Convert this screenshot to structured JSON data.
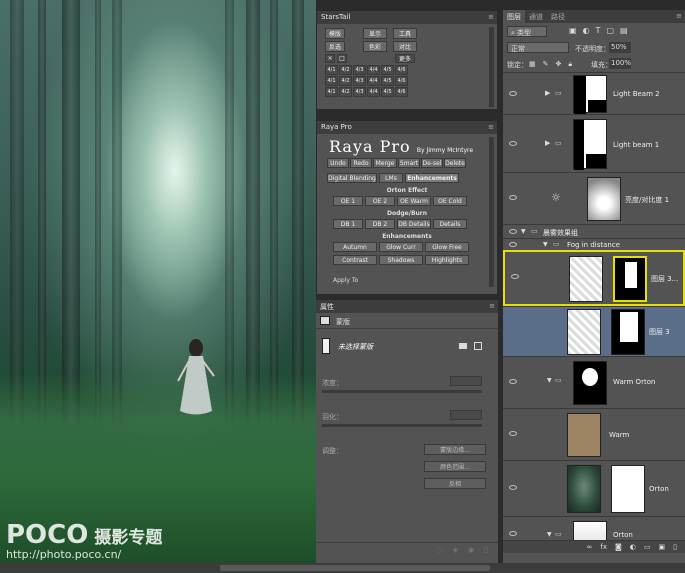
{
  "photo": {
    "logo_brand": "POCO",
    "logo_title": "摄影专题",
    "logo_url": "http://photo.poco.cn/"
  },
  "starstail": {
    "title": "StarsTail",
    "row1": [
      "模版",
      "显示",
      "工具"
    ],
    "row2": [
      "反选",
      "色彩",
      "对比"
    ],
    "row3_right": "更多",
    "row3_left": [
      "×",
      "□"
    ],
    "grid": [
      "4/1",
      "4/2",
      "4/3",
      "4/4",
      "4/5",
      "4/6",
      "4/1",
      "4/2",
      "4/3",
      "4/4",
      "4/5",
      "4/6",
      "4/1",
      "4/2",
      "4/3",
      "4/4",
      "4/5",
      "4/6"
    ]
  },
  "raya": {
    "title": "Raya Pro",
    "logo": "Raya Pro",
    "by": "By Jimmy McIntyre",
    "actions": [
      "Undo",
      "Redo",
      "Merge",
      "Smart",
      "De-sel",
      "Delete"
    ],
    "tabs": [
      "Digital Blending",
      "LMs",
      "Enhancements"
    ],
    "orton_heading": "Orton Effect",
    "orton": [
      "OE 1",
      "OE 2",
      "OE Warm",
      "OE Cold"
    ],
    "dodge_heading": "Dodge/Burn",
    "dodge": [
      "DB 1",
      "DB 2",
      "DB Details",
      "Details"
    ],
    "enh_heading": "Enhancements",
    "enh1": [
      "Autumn",
      "Glow Curr",
      "Glow Free"
    ],
    "enh2": [
      "Contrast",
      "Shadows",
      "Highlights"
    ],
    "apply_to": "Apply To"
  },
  "props": {
    "title": "属性",
    "section": "蒙版",
    "mask_name": "未选择蒙版",
    "density_label": "浓度：",
    "feather_label": "羽化：",
    "adjust_label": "调整：",
    "buttons": [
      "蒙版边缘...",
      "颜色范围...",
      "反相"
    ]
  },
  "layers": {
    "tabs": [
      "图层",
      "通道",
      "路径"
    ],
    "kind": "类型",
    "blend": "正常",
    "opacity_label": "不透明度：",
    "opacity": "50%",
    "lock_label": "锁定：",
    "fill_label": "填充：",
    "fill": "100%",
    "items": [
      {
        "name": "Light Beam 2"
      },
      {
        "name": "Light beam 1"
      },
      {
        "name": "亮度/对比度 1"
      },
      {
        "name": "晨雾效果组"
      },
      {
        "name": "Fog in distance"
      },
      {
        "name": "图层 3..."
      },
      {
        "name": "图层 3"
      },
      {
        "name": "Warm Orton"
      },
      {
        "name": "Warm"
      },
      {
        "name": "Orton"
      },
      {
        "name": "Orton"
      }
    ],
    "footer_icons": [
      "link-icon",
      "fx-icon",
      "mask-icon",
      "adjustment-icon",
      "folder-icon",
      "new-layer-icon",
      "trash-icon"
    ]
  },
  "colors": {
    "panel_bg": "#535353",
    "selected_layer": "#5a6e88",
    "highlight_border": "#e8e000",
    "warm_fill": "#9b8363"
  }
}
